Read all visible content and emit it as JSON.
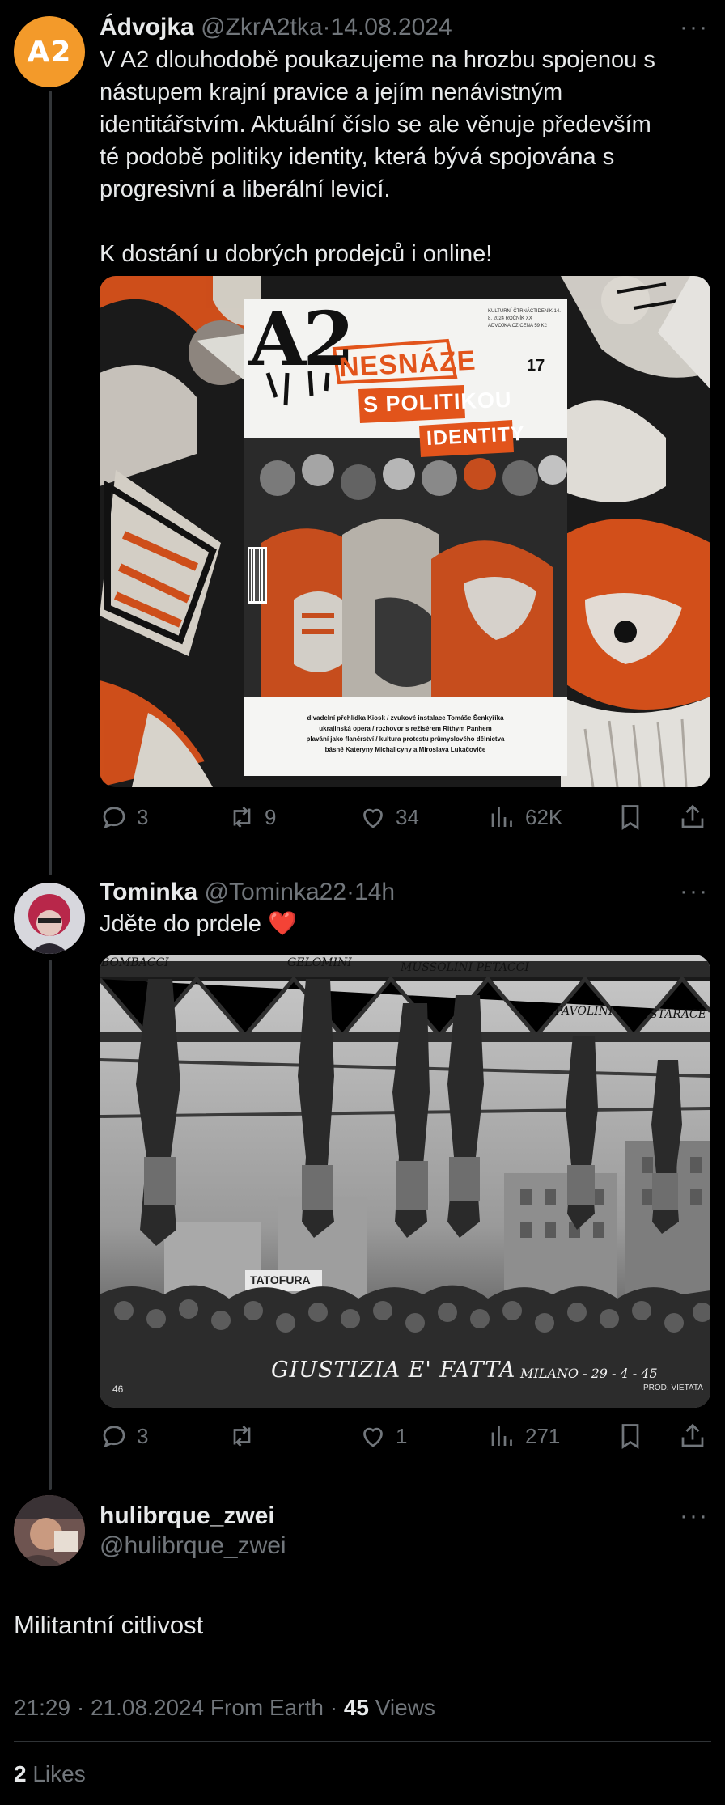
{
  "tweet1": {
    "avatar_text": "A2",
    "name": "Ádvojka",
    "handle": "@ZkrA2tka",
    "sep": "·",
    "date": "14.08.2024",
    "more": "···",
    "text_lines": [
      "V A2 dlouhodobě poukazujeme na hrozbu spojenou s",
      "nástupem krajní pravice a jejím nenávistným",
      "identitářstvím. Aktuální číslo se ale věnuje především",
      "té podobě politiky identity, která bývá spojována s",
      "progresivní a liberální levicí.",
      "",
      "K dostání u dobrých prodejců i online!"
    ],
    "image": {
      "logo": "A2",
      "issue_number": "17",
      "headline_1": "NESNÁZE",
      "headline_2": "S POLITIKOU",
      "headline_3": "IDENTITY",
      "masthead_small": "KULTURNÍ ČTRNÁCTIDENÍK  14. 8. 2024  ROČNÍK XX  ADVOJKA.CZ  CENA 59 Kč",
      "footer_1": "divadelní přehlídka Kiosk / zvukové instalace Tomáše Šenkyříka",
      "footer_2": "ukrajinská opera / rozhovor s režisérem Rithym Panhem",
      "footer_3": "plavání jako flanérství / kultura protestu průmyslového dělnictva",
      "footer_4": "básně Kateryny Michalicyny a Miroslava Lukačoviče"
    },
    "stats": {
      "replies": "3",
      "reposts": "9",
      "likes": "34",
      "views": "62K"
    }
  },
  "tweet2": {
    "name": "Tominka",
    "handle": "@Tominka22",
    "sep": "·",
    "time": "14h",
    "more": "···",
    "text": "Jděte do prdele",
    "emoji": "❤️",
    "image": {
      "labels": [
        "BOMBACCI",
        "GELOMINI",
        "MUSSOLINI PETACCI",
        "PAVOLINI",
        "STARACE"
      ],
      "caption": "GIUSTIZIA E' FATTA",
      "place_date": "MILANO - 29 - 4 - 45",
      "fine_print": "PROD. VIETATA",
      "sign": "TATOFURA",
      "corner": "46"
    },
    "stats": {
      "replies": "3",
      "reposts": "",
      "likes": "1",
      "views": "271"
    }
  },
  "tweet3": {
    "name": "hulibrque_zwei",
    "handle": "@hulibrque_zwei",
    "more": "···",
    "text": "Militantní citlivost",
    "time": "21:29",
    "sep": "·",
    "date": "21.08.2024",
    "source": "From Earth",
    "sep2": "·",
    "views_count": "45",
    "views_label": "Views",
    "likes_count": "2",
    "likes_label": "Likes"
  },
  "colors": {
    "background": "#000000",
    "text": "#e7e9ea",
    "muted": "#71767b",
    "a2_orange": "#f39a2a",
    "poster_orange": "#e2541b"
  }
}
